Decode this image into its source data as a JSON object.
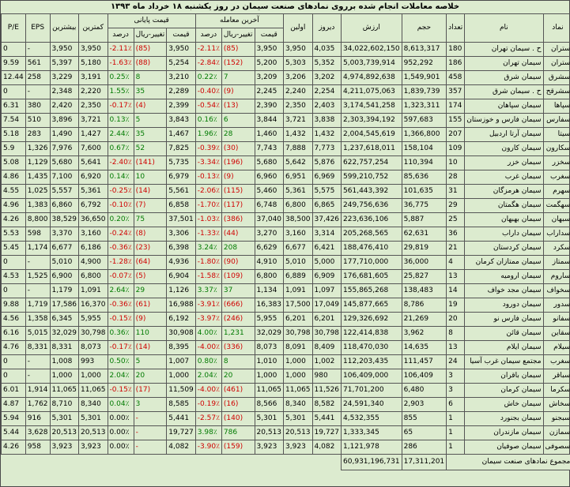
{
  "title": "خلاصه معاملات انجام شده برروی نمادهای صنعت سیمان در روز یکشنبه ۱۸ خرداد ماه ۱۳۹۳",
  "headers": {
    "pe": "P/E",
    "eps": "EPS",
    "max": "بیشترین",
    "min": "کمترین",
    "final_price_group": "قیمت پایانی",
    "last_trade_group": "آخرین معامله",
    "percent": "درصد",
    "change": "تغییر-ریال",
    "price": "قیمت",
    "first": "اولین",
    "yesterday": "دیروز",
    "value": "ارزش",
    "volume": "حجم",
    "count": "تعداد",
    "name": "نام",
    "symbol": "نماد"
  },
  "rows": [
    {
      "pe": "0",
      "eps": "-",
      "max": "3,950",
      "min": "3,950",
      "fp_pct": "-2.11٪",
      "fp_chg": "(85)",
      "fp_price": "3,950",
      "lt_pct": "-2.11٪",
      "lt_chg": "(85)",
      "lt_price": "3,950",
      "first": "3,950",
      "yesterday": "4,035",
      "value": "34,022,602,150",
      "volume": "8,613,317",
      "count": "180",
      "name": "ح . سیمان تهران",
      "symbol": "ستران",
      "dir": "down"
    },
    {
      "pe": "9.59",
      "eps": "561",
      "max": "5,397",
      "min": "5,180",
      "fp_pct": "-1.63٪",
      "fp_chg": "(88)",
      "fp_price": "5,254",
      "lt_pct": "-2.84٪",
      "lt_chg": "(152)",
      "lt_price": "5,200",
      "first": "5,303",
      "yesterday": "5,352",
      "value": "5,003,739,914",
      "volume": "952,292",
      "count": "186",
      "name": "سیمان تهران",
      "symbol": "ستران",
      "dir": "down"
    },
    {
      "pe": "12.44",
      "eps": "258",
      "max": "3,229",
      "min": "3,191",
      "fp_pct": "0.25٪",
      "fp_chg": "8",
      "fp_price": "3,210",
      "lt_pct": "0.22٪",
      "lt_chg": "7",
      "lt_price": "3,209",
      "first": "3,206",
      "yesterday": "3,202",
      "value": "4,974,892,638",
      "volume": "1,549,901",
      "count": "458",
      "name": "سیمان شرق",
      "symbol": "سشرق",
      "dir": "up"
    },
    {
      "pe": "0",
      "eps": "-",
      "max": "2,348",
      "min": "2,220",
      "fp_pct": "1.55٪",
      "fp_chg": "35",
      "fp_price": "2,289",
      "lt_pct": "-0.40٪",
      "lt_chg": "(9)",
      "lt_price": "2,245",
      "first": "2,240",
      "yesterday": "2,254",
      "value": "4,211,075,063",
      "volume": "1,839,739",
      "count": "357",
      "name": "ح . سیمان شرق",
      "symbol": "سشرقح",
      "dir": "mix"
    },
    {
      "pe": "6.31",
      "eps": "380",
      "max": "2,420",
      "min": "2,350",
      "fp_pct": "-0.17٪",
      "fp_chg": "(4)",
      "fp_price": "2,399",
      "lt_pct": "-0.54٪",
      "lt_chg": "(13)",
      "lt_price": "2,390",
      "first": "2,350",
      "yesterday": "2,403",
      "value": "3,174,541,258",
      "volume": "1,323,311",
      "count": "174",
      "name": "سیمان سپاهان",
      "symbol": "سپاها",
      "dir": "down"
    },
    {
      "pe": "7.54",
      "eps": "510",
      "max": "3,896",
      "min": "3,721",
      "fp_pct": "0.13٪",
      "fp_chg": "5",
      "fp_price": "3,843",
      "lt_pct": "0.16٪",
      "lt_chg": "6",
      "lt_price": "3,844",
      "first": "3,721",
      "yesterday": "3,838",
      "value": "2,303,394,192",
      "volume": "597,683",
      "count": "155",
      "name": "سیمان فارس و خوزستان",
      "symbol": "سفارس",
      "dir": "up"
    },
    {
      "pe": "5.18",
      "eps": "283",
      "max": "1,490",
      "min": "1,427",
      "fp_pct": "2.44٪",
      "fp_chg": "35",
      "fp_price": "1,467",
      "lt_pct": "1.96٪",
      "lt_chg": "28",
      "lt_price": "1,460",
      "first": "1,432",
      "yesterday": "1,432",
      "value": "2,004,545,619",
      "volume": "1,366,800",
      "count": "207",
      "name": "سیمان آرتا اردبیل",
      "symbol": "سیتا",
      "dir": "up"
    },
    {
      "pe": "5.9",
      "eps": "1,326",
      "max": "7,976",
      "min": "7,600",
      "fp_pct": "0.67٪",
      "fp_chg": "52",
      "fp_price": "7,825",
      "lt_pct": "-0.39٪",
      "lt_chg": "(30)",
      "lt_price": "7,743",
      "first": "7,888",
      "yesterday": "7,773",
      "value": "1,237,618,011",
      "volume": "158,104",
      "count": "109",
      "name": "سیمان کارون",
      "symbol": "سکارون",
      "dir": "mix"
    },
    {
      "pe": "5.08",
      "eps": "1,129",
      "max": "5,680",
      "min": "5,641",
      "fp_pct": "-2.40٪",
      "fp_chg": "(141)",
      "fp_price": "5,735",
      "lt_pct": "-3.34٪",
      "lt_chg": "(196)",
      "lt_price": "5,680",
      "first": "5,642",
      "yesterday": "5,876",
      "value": "622,757,254",
      "volume": "110,394",
      "count": "10",
      "name": "سیمان خزر",
      "symbol": "سخزر",
      "dir": "down"
    },
    {
      "pe": "4.86",
      "eps": "1,435",
      "max": "7,100",
      "min": "6,920",
      "fp_pct": "0.14٪",
      "fp_chg": "10",
      "fp_price": "6,979",
      "lt_pct": "-0.13٪",
      "lt_chg": "(9)",
      "lt_price": "6,960",
      "first": "6,951",
      "yesterday": "6,969",
      "value": "599,210,752",
      "volume": "85,636",
      "count": "28",
      "name": "سیمان غرب",
      "symbol": "سغرب",
      "dir": "mix"
    },
    {
      "pe": "4.55",
      "eps": "1,025",
      "max": "5,557",
      "min": "5,361",
      "fp_pct": "-0.25٪",
      "fp_chg": "(14)",
      "fp_price": "5,561",
      "lt_pct": "-2.06٪",
      "lt_chg": "(115)",
      "lt_price": "5,460",
      "first": "5,361",
      "yesterday": "5,575",
      "value": "561,443,392",
      "volume": "101,635",
      "count": "31",
      "name": "سیمان هرمزگان",
      "symbol": "سهرم",
      "dir": "down"
    },
    {
      "pe": "4.96",
      "eps": "1,383",
      "max": "6,860",
      "min": "6,792",
      "fp_pct": "-0.10٪",
      "fp_chg": "(7)",
      "fp_price": "6,858",
      "lt_pct": "-1.70٪",
      "lt_chg": "(117)",
      "lt_price": "6,748",
      "first": "6,800",
      "yesterday": "6,865",
      "value": "249,756,636",
      "volume": "36,775",
      "count": "29",
      "name": "سیمان هگمتان",
      "symbol": "سهگمت",
      "dir": "down"
    },
    {
      "pe": "4.26",
      "eps": "8,800",
      "max": "38,529",
      "min": "36,650",
      "fp_pct": "0.20٪",
      "fp_chg": "75",
      "fp_price": "37,501",
      "lt_pct": "-1.03٪",
      "lt_chg": "(386)",
      "lt_price": "37,040",
      "first": "38,500",
      "yesterday": "37,426",
      "value": "223,636,106",
      "volume": "5,887",
      "count": "25",
      "name": "سیمان بهبهان",
      "symbol": "سبهان",
      "dir": "mix"
    },
    {
      "pe": "5.53",
      "eps": "598",
      "max": "3,370",
      "min": "3,160",
      "fp_pct": "-0.24٪",
      "fp_chg": "(8)",
      "fp_price": "3,306",
      "lt_pct": "-1.33٪",
      "lt_chg": "(44)",
      "lt_price": "3,270",
      "first": "3,160",
      "yesterday": "3,314",
      "value": "205,268,565",
      "volume": "62,631",
      "count": "36",
      "name": "سیمان داراب",
      "symbol": "سداراب",
      "dir": "down"
    },
    {
      "pe": "5.45",
      "eps": "1,174",
      "max": "6,677",
      "min": "6,186",
      "fp_pct": "-0.36٪",
      "fp_chg": "(23)",
      "fp_price": "6,398",
      "lt_pct": "3.24٪",
      "lt_chg": "208",
      "lt_price": "6,629",
      "first": "6,677",
      "yesterday": "6,421",
      "value": "188,476,410",
      "volume": "29,819",
      "count": "21",
      "name": "سیمان کردستان",
      "symbol": "سکرد",
      "dir": "mix"
    },
    {
      "pe": "0",
      "eps": "-",
      "max": "5,010",
      "min": "4,900",
      "fp_pct": "-1.28٪",
      "fp_chg": "(64)",
      "fp_price": "4,936",
      "lt_pct": "-1.80٪",
      "lt_chg": "(90)",
      "lt_price": "4,910",
      "first": "5,010",
      "yesterday": "5,000",
      "value": "177,710,000",
      "volume": "36,000",
      "count": "4",
      "name": "سیمان ممتازان کرمان",
      "symbol": "سمتاز",
      "dir": "down"
    },
    {
      "pe": "4.53",
      "eps": "1,525",
      "max": "6,900",
      "min": "6,800",
      "fp_pct": "-0.07٪",
      "fp_chg": "(5)",
      "fp_price": "6,904",
      "lt_pct": "-1.58٪",
      "lt_chg": "(109)",
      "lt_price": "6,800",
      "first": "6,889",
      "yesterday": "6,909",
      "value": "176,681,605",
      "volume": "25,827",
      "count": "13",
      "name": "سیمان ارومیه",
      "symbol": "ساروم",
      "dir": "down"
    },
    {
      "pe": "0",
      "eps": "-",
      "max": "1,179",
      "min": "1,091",
      "fp_pct": "2.64٪",
      "fp_chg": "29",
      "fp_price": "1,126",
      "lt_pct": "3.37٪",
      "lt_chg": "37",
      "lt_price": "1,134",
      "first": "1,091",
      "yesterday": "1,097",
      "value": "155,865,268",
      "volume": "138,483",
      "count": "14",
      "name": "سیمان مجد خواف",
      "symbol": "سخواف",
      "dir": "up"
    },
    {
      "pe": "9.88",
      "eps": "1,719",
      "max": "17,586",
      "min": "16,370",
      "fp_pct": "-0.36٪",
      "fp_chg": "(61)",
      "fp_price": "16,988",
      "lt_pct": "-3.91٪",
      "lt_chg": "(666)",
      "lt_price": "16,383",
      "first": "17,500",
      "yesterday": "17,049",
      "value": "145,877,665",
      "volume": "8,786",
      "count": "19",
      "name": "سیمان دورود",
      "symbol": "سدور",
      "dir": "down"
    },
    {
      "pe": "4.56",
      "eps": "1,358",
      "max": "6,345",
      "min": "5,955",
      "fp_pct": "-0.15٪",
      "fp_chg": "(9)",
      "fp_price": "6,192",
      "lt_pct": "-3.97٪",
      "lt_chg": "(246)",
      "lt_price": "5,955",
      "first": "6,201",
      "yesterday": "6,201",
      "value": "129,326,692",
      "volume": "21,269",
      "count": "20",
      "name": "سیمان فارس نو",
      "symbol": "سفانو",
      "dir": "down"
    },
    {
      "pe": "6.16",
      "eps": "5,015",
      "max": "32,029",
      "min": "30,798",
      "fp_pct": "0.36٪",
      "fp_chg": "110",
      "fp_price": "30,908",
      "lt_pct": "4.00٪",
      "lt_chg": "1,231",
      "lt_price": "32,029",
      "first": "30,798",
      "yesterday": "30,798",
      "value": "122,414,838",
      "volume": "3,962",
      "count": "8",
      "name": "سیمان قائن",
      "symbol": "سقاین",
      "dir": "up"
    },
    {
      "pe": "4.76",
      "eps": "8,331",
      "max": "8,331",
      "min": "8,073",
      "fp_pct": "-0.17٪",
      "fp_chg": "(14)",
      "fp_price": "8,395",
      "lt_pct": "-4.00٪",
      "lt_chg": "(336)",
      "lt_price": "8,073",
      "first": "8,091",
      "yesterday": "8,409",
      "value": "118,470,030",
      "volume": "14,635",
      "count": "13",
      "name": "سیمان ایلام",
      "symbol": "سیلام",
      "dir": "down"
    },
    {
      "pe": "0",
      "eps": "-",
      "max": "1,008",
      "min": "993",
      "fp_pct": "0.50٪",
      "fp_chg": "5",
      "fp_price": "1,007",
      "lt_pct": "0.80٪",
      "lt_chg": "8",
      "lt_price": "1,010",
      "first": "1,000",
      "yesterday": "1,002",
      "value": "112,203,435",
      "volume": "111,457",
      "count": "24",
      "name": "مجتمع سیمان غرب آسیا",
      "symbol": "سغرب",
      "dir": "up"
    },
    {
      "pe": "0",
      "eps": "-",
      "max": "1,000",
      "min": "1,000",
      "fp_pct": "2.04٪",
      "fp_chg": "20",
      "fp_price": "1,000",
      "lt_pct": "2.04٪",
      "lt_chg": "20",
      "lt_price": "1,000",
      "first": "1,000",
      "yesterday": "980",
      "value": "106,409,000",
      "volume": "106,409",
      "count": "3",
      "name": "سیمان باقران",
      "symbol": "سباقر",
      "dir": "up"
    },
    {
      "pe": "6.01",
      "eps": "1,914",
      "max": "11,065",
      "min": "11,065",
      "fp_pct": "-0.15٪",
      "fp_chg": "(17)",
      "fp_price": "11,509",
      "lt_pct": "-4.00٪",
      "lt_chg": "(461)",
      "lt_price": "11,065",
      "first": "11,065",
      "yesterday": "11,526",
      "value": "71,701,200",
      "volume": "6,480",
      "count": "3",
      "name": "سیمان کرمان",
      "symbol": "سکرما",
      "dir": "down"
    },
    {
      "pe": "4.87",
      "eps": "1,762",
      "max": "8,710",
      "min": "8,340",
      "fp_pct": "0.04٪",
      "fp_chg": "3",
      "fp_price": "8,585",
      "lt_pct": "-0.19٪",
      "lt_chg": "(16)",
      "lt_price": "8,566",
      "first": "8,340",
      "yesterday": "8,582",
      "value": "24,591,340",
      "volume": "2,903",
      "count": "6",
      "name": "سیمان خاش",
      "symbol": "سخاش",
      "dir": "mix"
    },
    {
      "pe": "5.94",
      "eps": "916",
      "max": "5,301",
      "min": "5,301",
      "fp_pct": "0.00٪",
      "fp_chg": "-",
      "fp_price": "5,441",
      "lt_pct": "-2.57٪",
      "lt_chg": "(140)",
      "lt_price": "5,301",
      "first": "5,301",
      "yesterday": "5,441",
      "value": "4,532,355",
      "volume": "855",
      "count": "1",
      "name": "سیمان بجنورد",
      "symbol": "سبجنو",
      "dir": "down"
    },
    {
      "pe": "5.44",
      "eps": "3,628",
      "max": "20,513",
      "min": "20,513",
      "fp_pct": "0.00٪",
      "fp_chg": "-",
      "fp_price": "19,727",
      "lt_pct": "3.98٪",
      "lt_chg": "786",
      "lt_price": "20,513",
      "first": "20,513",
      "yesterday": "19,727",
      "value": "1,333,345",
      "volume": "65",
      "count": "1",
      "name": "سیمان مازندران",
      "symbol": "سمازن",
      "dir": "up"
    },
    {
      "pe": "4.26",
      "eps": "958",
      "max": "3,923",
      "min": "3,923",
      "fp_pct": "0.00٪",
      "fp_chg": "-",
      "fp_price": "4,082",
      "lt_pct": "-3.90٪",
      "lt_chg": "(159)",
      "lt_price": "3,923",
      "first": "3,923",
      "yesterday": "4,082",
      "value": "1,121,978",
      "volume": "286",
      "count": "1",
      "name": "سیمان صوفیان",
      "symbol": "سصوفی",
      "dir": "down"
    }
  ],
  "footer": {
    "total_value": "60,931,196,731",
    "total_volume": "17,311,201",
    "label": "مجموع نمادهای صنعت سیمان"
  },
  "colors": {
    "background": "#dcebcf",
    "positive": "#007a00",
    "negative": "#d00000"
  }
}
